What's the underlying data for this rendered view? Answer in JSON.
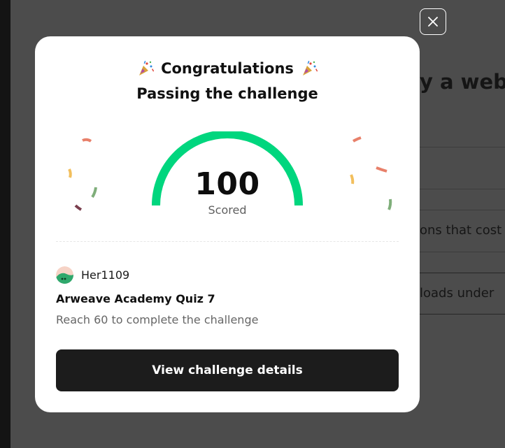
{
  "background": {
    "heading_fragment": "y a websi",
    "row_texts": [
      "ons that cost m",
      "loads under"
    ]
  },
  "modal": {
    "title": "Congratulations",
    "subtitle": "Passing the challenge",
    "score": {
      "value": "100",
      "label": "Scored",
      "fraction": 1.0,
      "color": "#00d67e"
    },
    "user": {
      "name": "Her1109"
    },
    "quiz_name": "Arweave Academy Quiz 7",
    "requirement": "Reach 60 to complete the challenge",
    "cta_label": "View challenge details"
  },
  "icons": {
    "close": "close-icon",
    "celebration": "party-popper-icon",
    "avatar": "user-avatar"
  },
  "colors": {
    "overlay": "#4a4a4a",
    "gauge": "#00d67e",
    "button": "#1c1c1c"
  }
}
